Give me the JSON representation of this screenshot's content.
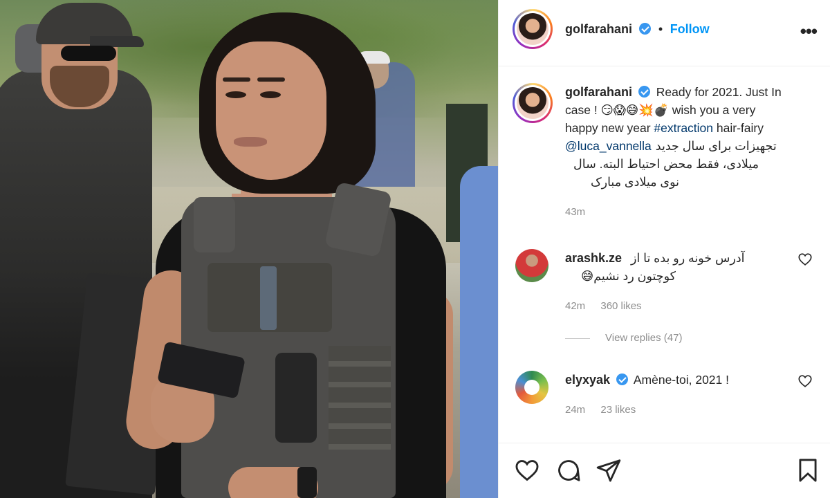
{
  "post": {
    "image_alt_icon": "photo-of-woman-in-tactical-vest"
  },
  "header": {
    "username": "golfarahani",
    "separator": "•",
    "follow_label": "Follow",
    "more_icon": "more-dots-icon",
    "more_label": "•••"
  },
  "caption": {
    "username": "golfarahani",
    "line1": "Ready for 2021. Just In",
    "line2_text": "case ! ",
    "line2_emoji": "😏😱😅💥💣",
    "line2_rest": " wish you a very",
    "line3_text": "happy new year ",
    "hashtag": "#extraction",
    "line3_rest": " hair-fairy",
    "mention": "@luca_vannella",
    "rtl_line1": "تجهیزات برای سال جدید",
    "rtl_line2": "میلادی، فقط محض احتیاط البته. سال",
    "rtl_line3": "نوی میلادی مبارک",
    "time": "43m"
  },
  "comments": [
    {
      "username": "arashk.ze",
      "text_line1": "آدرس خونه رو بده تا از",
      "text_line2": "کوچتون رد نشیم😅",
      "time": "42m",
      "likes": "360 likes",
      "view_replies": "View replies (47)"
    },
    {
      "username": "elyxyak",
      "text": "Amène-toi, 2021 !",
      "time": "24m",
      "likes": "23 likes"
    }
  ],
  "actions": {
    "like_icon": "heart-icon",
    "comment_icon": "comment-icon",
    "share_icon": "share-icon",
    "save_icon": "bookmark-icon"
  },
  "colors": {
    "link": "#00376b",
    "follow": "#0095f6",
    "verified": "#3897f0",
    "muted": "#8e8e8e"
  }
}
